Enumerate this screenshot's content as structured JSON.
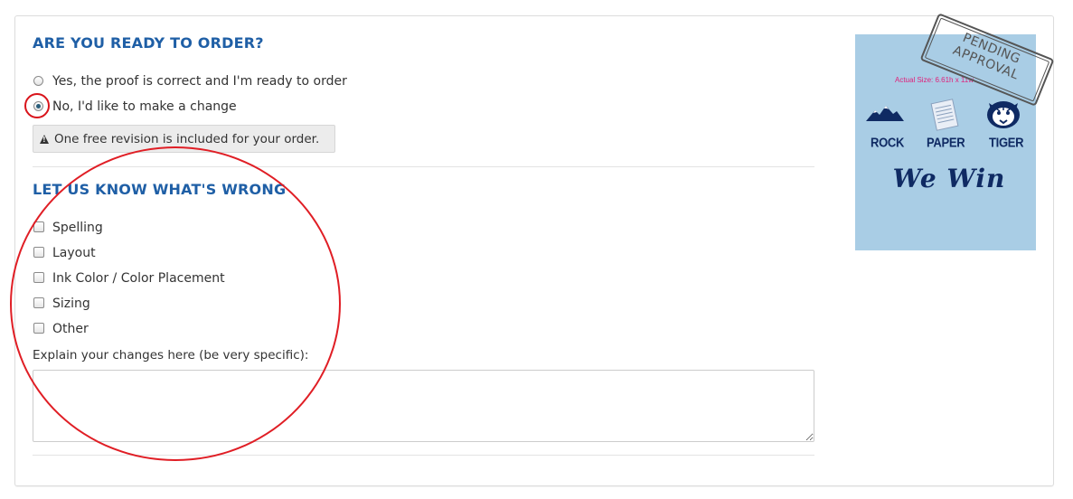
{
  "order_section": {
    "heading": "ARE YOU READY TO ORDER?",
    "options": [
      {
        "label": "Yes, the proof is correct and I'm ready to order",
        "selected": false
      },
      {
        "label": "No, I'd like to make a change",
        "selected": true
      }
    ],
    "notice": "One free revision is included for your order."
  },
  "feedback_section": {
    "heading": "LET US KNOW WHAT'S WRONG",
    "checkboxes": [
      {
        "label": "Spelling",
        "checked": false
      },
      {
        "label": "Layout",
        "checked": false
      },
      {
        "label": "Ink Color / Color Placement",
        "checked": false
      },
      {
        "label": "Sizing",
        "checked": false
      },
      {
        "label": "Other",
        "checked": false
      }
    ],
    "explain_label": "Explain your changes here (be very specific):",
    "explain_value": ""
  },
  "proof": {
    "background_color": "#a9cde5",
    "stamp_line1": "PENDING",
    "stamp_line2": "APPROVAL",
    "actual_size": "Actual Size: 6.61h x 11w",
    "mascots": [
      {
        "label": "ROCK",
        "icon": "mountain-icon"
      },
      {
        "label": "PAPER",
        "icon": "paper-icon"
      },
      {
        "label": "TIGER",
        "icon": "tiger-icon"
      }
    ],
    "motto": "We Win"
  },
  "colors": {
    "heading": "#1f5fa6",
    "annotation": "#e01e25",
    "design_ink": "#0f2a63"
  }
}
